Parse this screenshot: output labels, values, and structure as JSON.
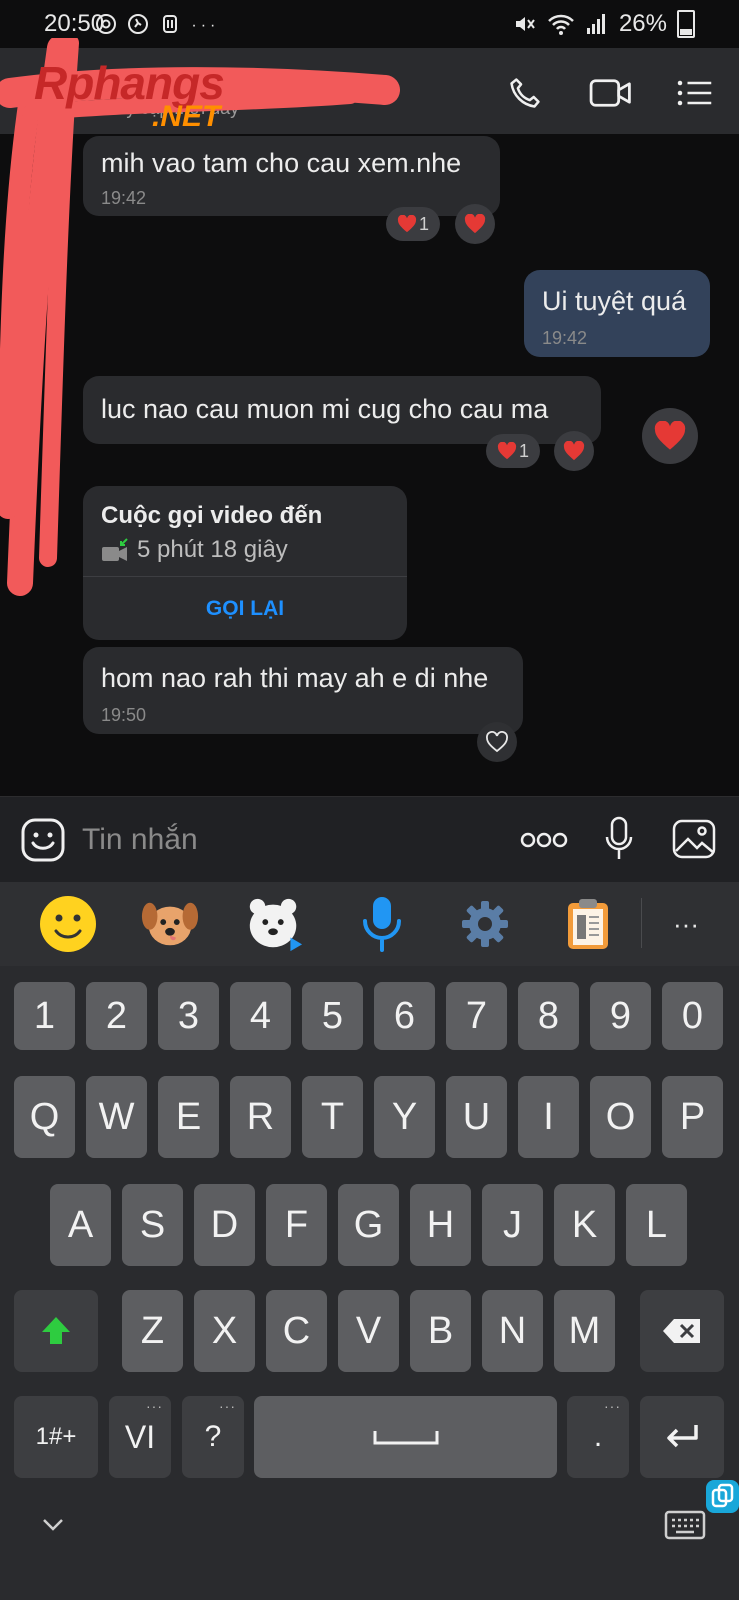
{
  "status_bar": {
    "time": "20:50",
    "icons": [
      "at-icon",
      "activity-icon",
      "clip-icon",
      "more-dots-icon"
    ],
    "more": "···",
    "battery": "26%"
  },
  "header": {
    "subtitle": "Truy cập mới đây",
    "watermark_main": "Rphangs",
    "watermark_sub": ".NET"
  },
  "messages": [
    {
      "side": "left",
      "text": "mih vao tam cho cau xem.nhe",
      "time": "19:42",
      "reaction_count": "1"
    },
    {
      "side": "right",
      "text": "Ui tuyệt quá",
      "time": "19:42"
    },
    {
      "side": "left",
      "text": "luc nao cau muon mi cug cho cau ma",
      "reaction_count": "1"
    },
    {
      "side": "left",
      "text": "hom nao rah thi may ah e di nhe",
      "time": "19:50"
    }
  ],
  "call_card": {
    "title": "Cuộc gọi video đến",
    "duration": "5 phút 18 giây",
    "action": "GỌI LẠI"
  },
  "composer": {
    "placeholder": "Tin nhắn",
    "more_label": "ooo"
  },
  "keyboard": {
    "row_numbers": [
      "1",
      "2",
      "3",
      "4",
      "5",
      "6",
      "7",
      "8",
      "9",
      "0"
    ],
    "row_1": [
      "Q",
      "W",
      "E",
      "R",
      "T",
      "Y",
      "U",
      "I",
      "O",
      "P"
    ],
    "row_2": [
      "A",
      "S",
      "D",
      "F",
      "G",
      "H",
      "J",
      "K",
      "L"
    ],
    "row_3": [
      "Z",
      "X",
      "C",
      "V",
      "B",
      "N",
      "M"
    ],
    "symbols": "1#+",
    "lang": "VI",
    "question": "?",
    "period": ".",
    "more": "···",
    "accent_color": "#1e90ff",
    "reaction_color": "#e53935"
  }
}
